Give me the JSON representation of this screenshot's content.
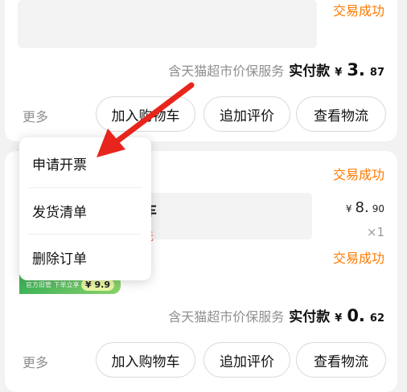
{
  "orders": [
    {
      "status": "交易成功",
      "service": "含天猫超市价保服务",
      "paid_label": "实付款",
      "currency": "¥",
      "paid_int": "3.",
      "paid_dec": "87",
      "more": "更多",
      "buttons": [
        "加入购物车",
        "追加评价",
        "查看物流"
      ]
    },
    {
      "status_top": "交易成功",
      "title_fragment": "车",
      "red_fragment": "无",
      "price_currency": "¥",
      "price_int": "8.",
      "price_dec": "90",
      "quantity": "×1",
      "status_mid": "交易成功",
      "banner_text": "官方旧管 下单立享",
      "banner_price": "¥ 9.9",
      "service": "含天猫超市价保服务",
      "paid_label": "实付款",
      "currency": "¥",
      "paid_int": "0.",
      "paid_dec": "62",
      "more": "更多",
      "buttons": [
        "加入购物车",
        "追加评价",
        "查看物流"
      ]
    }
  ],
  "popup_menu": {
    "items": [
      "申请开票",
      "发货清单",
      "删除订单"
    ]
  },
  "annotation": {
    "arrow_color": "#e8251c"
  }
}
